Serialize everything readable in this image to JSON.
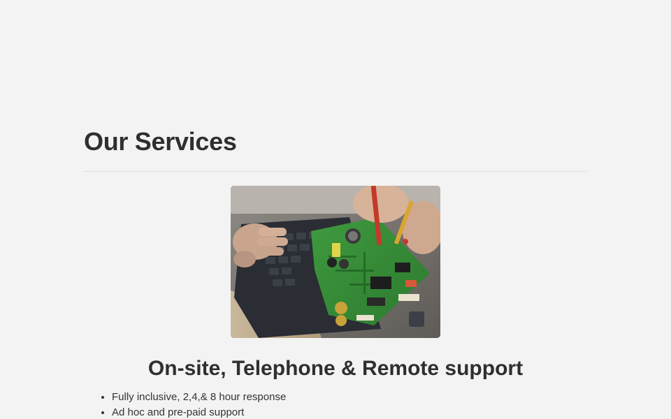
{
  "section": {
    "title": "Our Services"
  },
  "hero_image": {
    "icon": "circuit-board-repair-photo"
  },
  "service": {
    "heading": "On-site, Telephone & Remote support",
    "features": [
      "Fully inclusive, 2,4,& 8 hour response",
      "Ad hoc and pre-paid support"
    ]
  },
  "colors": {
    "background": "#f3f3f3",
    "text": "#2f2f2f",
    "divider": "#dedede"
  }
}
